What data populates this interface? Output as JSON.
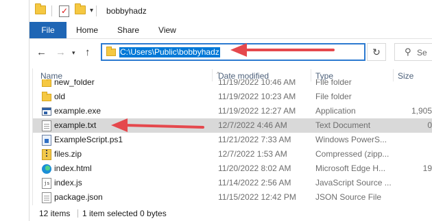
{
  "window": {
    "title": "bobbyhadz"
  },
  "ribbon": {
    "tabs": [
      "File",
      "Home",
      "Share",
      "View"
    ]
  },
  "address": {
    "path": "C:\\Users\\Public\\bobbyhadz",
    "search_placeholder": "Se"
  },
  "columns": {
    "name": "Name",
    "date": "Date modified",
    "type": "Type",
    "size": "Size"
  },
  "files": [
    {
      "name": "new_folder",
      "date": "11/19/2022 10:46 AM",
      "type": "File folder",
      "size": "",
      "icon": "folder-icon",
      "selected": false
    },
    {
      "name": "old",
      "date": "11/19/2022 10:23 AM",
      "type": "File folder",
      "size": "",
      "icon": "folder-icon",
      "selected": false
    },
    {
      "name": "example.exe",
      "date": "11/19/2022 12:27 AM",
      "type": "Application",
      "size": "1,905",
      "icon": "exe-icon",
      "selected": false
    },
    {
      "name": "example.txt",
      "date": "12/7/2022 4:46 AM",
      "type": "Text Document",
      "size": "0",
      "icon": "text-file-icon",
      "selected": true
    },
    {
      "name": "ExampleScript.ps1",
      "date": "11/21/2022 7:33 AM",
      "type": "Windows PowerS...",
      "size": "",
      "icon": "powershell-file-icon",
      "selected": false
    },
    {
      "name": "files.zip",
      "date": "12/7/2022 1:53 AM",
      "type": "Compressed (zipp...",
      "size": "",
      "icon": "zip-icon",
      "selected": false
    },
    {
      "name": "index.html",
      "date": "11/20/2022 8:02 AM",
      "type": "Microsoft Edge H...",
      "size": "19",
      "icon": "edge-icon",
      "selected": false
    },
    {
      "name": "index.js",
      "date": "11/14/2022 2:56 AM",
      "type": "JavaScript Source ...",
      "size": "",
      "icon": "js-file-icon",
      "selected": false
    },
    {
      "name": "package.json",
      "date": "11/15/2022 12:42 PM",
      "type": "JSON Source File",
      "size": "",
      "icon": "json-file-icon",
      "selected": false
    }
  ],
  "status": {
    "items_count": "12 items",
    "selection": "1 item selected  0 bytes"
  },
  "colors": {
    "accent": "#1f66b5",
    "selection_highlight": "#0078d7",
    "annotation_arrow": "#e5484d"
  }
}
